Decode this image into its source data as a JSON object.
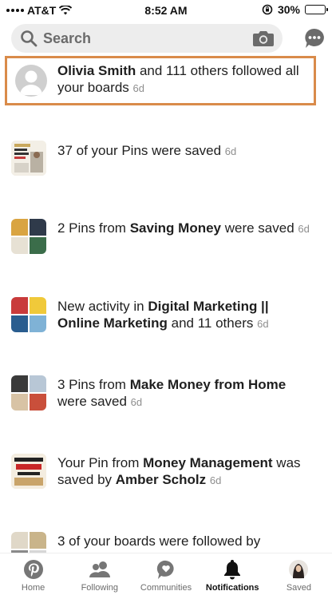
{
  "status_bar": {
    "carrier": "AT&T",
    "time": "8:52 AM",
    "battery": "30%",
    "battery_level": 0.3
  },
  "search": {
    "placeholder": "Search"
  },
  "notifications": [
    {
      "prefix": "",
      "bold1": "Olivia Smith",
      "mid": " and 111 others followed all your boards",
      "bold2": "",
      "suffix": "",
      "age": "6d"
    },
    {
      "prefix": "37 of your Pins were saved",
      "bold1": "",
      "mid": "",
      "bold2": "",
      "suffix": "",
      "age": "6d"
    },
    {
      "prefix": "2 Pins from ",
      "bold1": "Saving Money",
      "mid": " were saved",
      "bold2": "",
      "suffix": "",
      "age": "6d"
    },
    {
      "prefix": "New activity in ",
      "bold1": "Digital Marketing || Online Marketing",
      "mid": " and 11 others",
      "bold2": "",
      "suffix": "",
      "age": "6d"
    },
    {
      "prefix": "3 Pins from ",
      "bold1": "Make Money from Home",
      "mid": " were saved",
      "bold2": "",
      "suffix": "",
      "age": "6d"
    },
    {
      "prefix": "Your Pin from ",
      "bold1": "Money Management",
      "mid": " was saved by ",
      "bold2": "Amber Scholz",
      "suffix": "",
      "age": "6d"
    },
    {
      "prefix": "3 of your boards were followed by",
      "bold1": "",
      "mid": "",
      "bold2": "",
      "suffix": "",
      "age": ""
    }
  ],
  "tabs": [
    {
      "label": "Home",
      "icon": "pinterest-logo-icon"
    },
    {
      "label": "Following",
      "icon": "people-icon"
    },
    {
      "label": "Communities",
      "icon": "chat-bubble-icon"
    },
    {
      "label": "Notifications",
      "icon": "bell-icon"
    },
    {
      "label": "Saved",
      "icon": "profile-avatar"
    }
  ],
  "colors": {
    "highlight_border": "#d98b4a",
    "pinterest_red": "#e60023",
    "muted_text": "#8e8e8e"
  }
}
